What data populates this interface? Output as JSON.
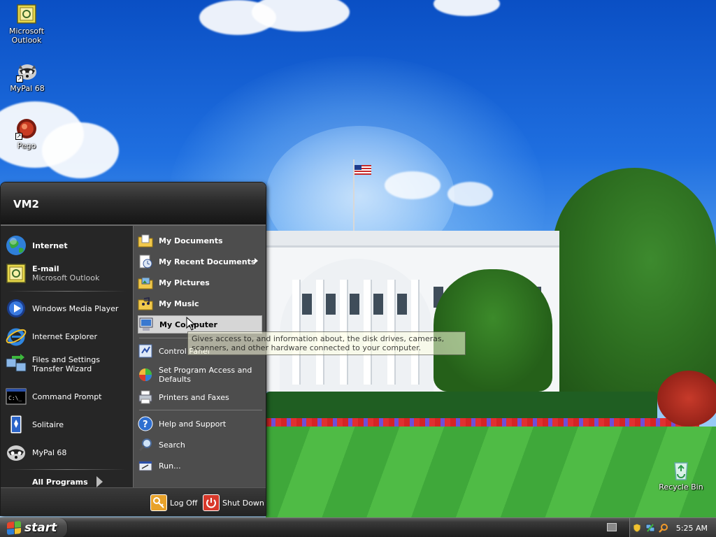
{
  "desktop": {
    "icons": [
      {
        "label": "Microsoft Outlook",
        "icon": "outlook-icon"
      },
      {
        "label": "MyPal 68",
        "icon": "mypal-raccoon-icon"
      },
      {
        "label": "Pego",
        "icon": "pego-icon"
      },
      {
        "label": "Recycle Bin",
        "icon": "recycle-bin-icon"
      }
    ]
  },
  "start_menu": {
    "user": "VM2",
    "pinned": [
      {
        "label": "Internet",
        "sublabel": "",
        "icon": "globe-icon"
      },
      {
        "label": "E-mail",
        "sublabel": "Microsoft Outlook",
        "icon": "outlook-icon"
      }
    ],
    "recent": [
      {
        "label": "Windows Media Player",
        "icon": "media-player-icon"
      },
      {
        "label": "Internet Explorer",
        "icon": "internet-explorer-icon"
      },
      {
        "label": "Files and Settings Transfer Wizard",
        "icon": "transfer-wizard-icon"
      },
      {
        "label": "Command Prompt",
        "icon": "command-prompt-icon"
      },
      {
        "label": "Solitaire",
        "icon": "solitaire-icon"
      },
      {
        "label": "MyPal 68",
        "icon": "mypal-raccoon-icon"
      }
    ],
    "all_programs": "All Programs",
    "places": [
      {
        "label": "My Documents",
        "icon": "folder-documents-icon"
      },
      {
        "label": "My Recent Documents",
        "icon": "recent-documents-icon"
      },
      {
        "label": "My Pictures",
        "icon": "folder-pictures-icon"
      },
      {
        "label": "My Music",
        "icon": "folder-music-icon"
      },
      {
        "label": "My Computer",
        "icon": "computer-icon"
      }
    ],
    "system": [
      {
        "label": "Control Panel",
        "icon": "control-panel-icon"
      },
      {
        "label": "Set Program Access and Defaults",
        "icon": "program-access-icon"
      },
      {
        "label": "Printers and Faxes",
        "icon": "printer-icon"
      }
    ],
    "help": [
      {
        "label": "Help and Support",
        "icon": "help-icon"
      },
      {
        "label": "Search",
        "icon": "search-icon"
      },
      {
        "label": "Run...",
        "icon": "run-icon"
      }
    ],
    "log_off": "Log Off",
    "shut_down": "Shut Down"
  },
  "tooltip": "Gives access to, and information about, the disk drives, cameras, scanners, and other hardware connected to your computer.",
  "taskbar": {
    "start_label": "start",
    "clock": "5:25 AM"
  }
}
